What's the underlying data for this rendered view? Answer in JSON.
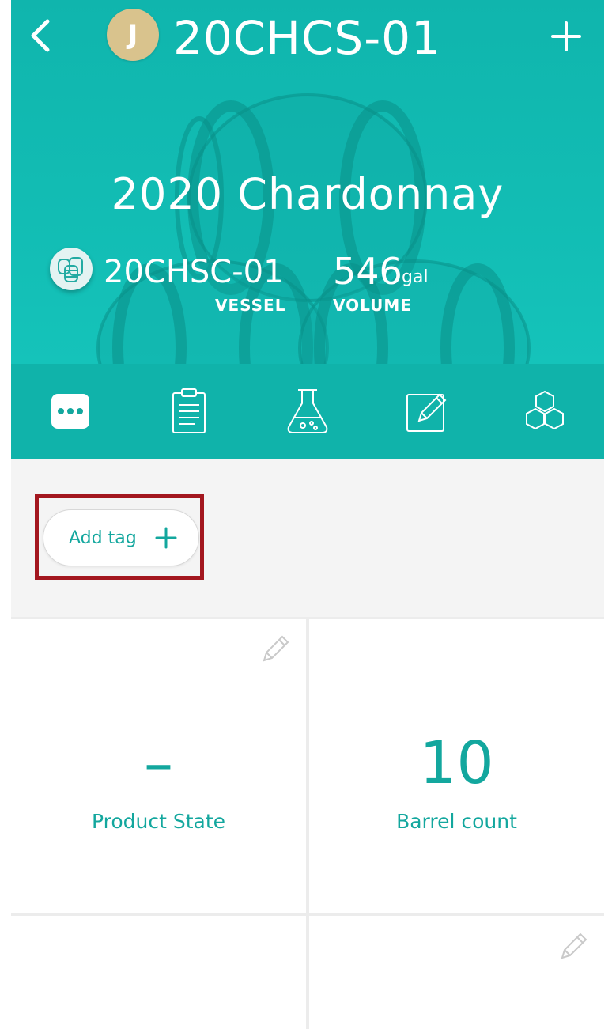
{
  "header": {
    "back_icon": "chevron-left-icon",
    "avatar_initial": "J",
    "title": "20CHCS-01",
    "add_icon": "plus-icon",
    "product_name": "2020 Chardonnay",
    "vessel": {
      "icon": "barrels-icon",
      "value": "20CHSC-01",
      "label": "VESSEL"
    },
    "volume": {
      "value": "546",
      "unit": "gal",
      "label": "VOLUME"
    }
  },
  "tabs": [
    {
      "icon": "more-dots-icon",
      "active": true
    },
    {
      "icon": "clipboard-icon",
      "active": false
    },
    {
      "icon": "flask-icon",
      "active": false
    },
    {
      "icon": "edit-note-icon",
      "active": false
    },
    {
      "icon": "hexagons-icon",
      "active": false
    }
  ],
  "tags": {
    "add_label": "Add tag",
    "add_icon": "plus-icon"
  },
  "cards": [
    {
      "value": "–",
      "label": "Product State",
      "editable": true
    },
    {
      "value": "10",
      "label": "Barrel count",
      "editable": false
    },
    {
      "value": "",
      "label": "",
      "editable": false
    },
    {
      "value": "",
      "label": "",
      "editable": true
    }
  ],
  "colors": {
    "teal": "#12bdb4",
    "teal_dark": "#10b3aa",
    "accent_text": "#13a79e",
    "avatar": "#d9c38d",
    "highlight": "#a3171f"
  }
}
